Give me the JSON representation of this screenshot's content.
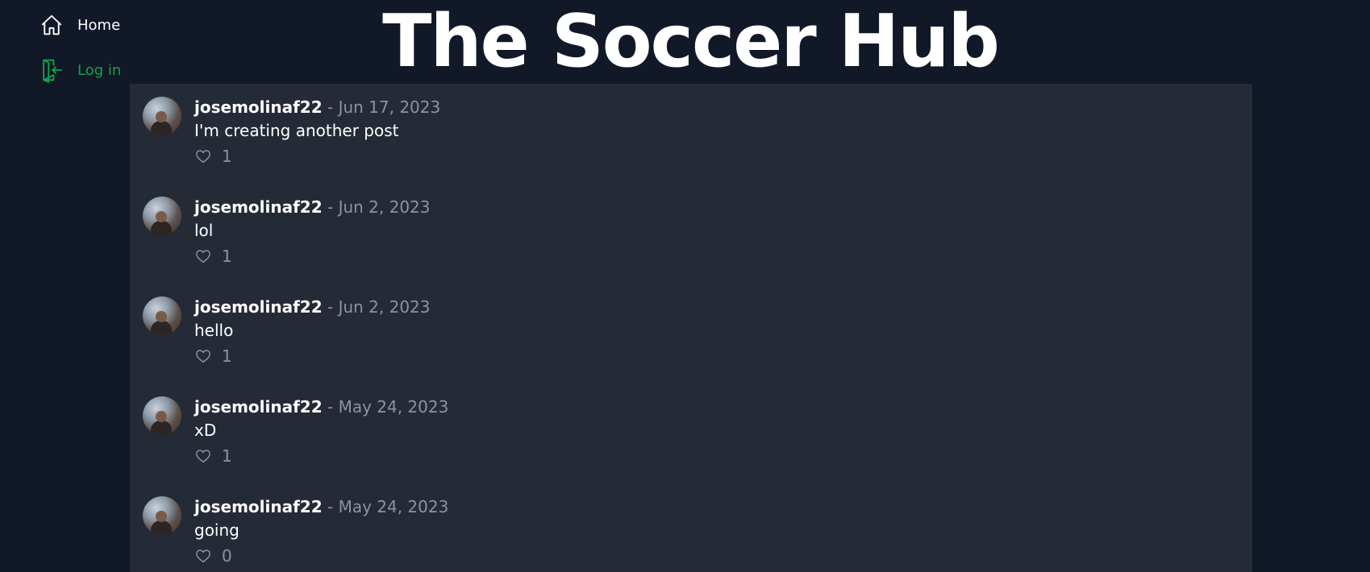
{
  "site": {
    "title": "The Soccer Hub"
  },
  "nav": {
    "items": [
      {
        "label": "Home",
        "icon": "home-icon"
      },
      {
        "label": "Log in",
        "icon": "login-icon",
        "color": "#16a34a"
      }
    ]
  },
  "colors": {
    "background": "#111827",
    "feed": "#252a37",
    "accent": "#16a34a",
    "muted": "#8b93a1"
  },
  "posts": [
    {
      "username": "josemolinaf22",
      "separator": "-",
      "date": "Jun 17, 2023",
      "content": "I'm creating another post",
      "likes": "1"
    },
    {
      "username": "josemolinaf22",
      "separator": "-",
      "date": "Jun 2, 2023",
      "content": "lol",
      "likes": "1"
    },
    {
      "username": "josemolinaf22",
      "separator": "-",
      "date": "Jun 2, 2023",
      "content": "hello",
      "likes": "1"
    },
    {
      "username": "josemolinaf22",
      "separator": "-",
      "date": "May 24, 2023",
      "content": "xD",
      "likes": "1"
    },
    {
      "username": "josemolinaf22",
      "separator": "-",
      "date": "May 24, 2023",
      "content": "going",
      "likes": "0"
    }
  ]
}
